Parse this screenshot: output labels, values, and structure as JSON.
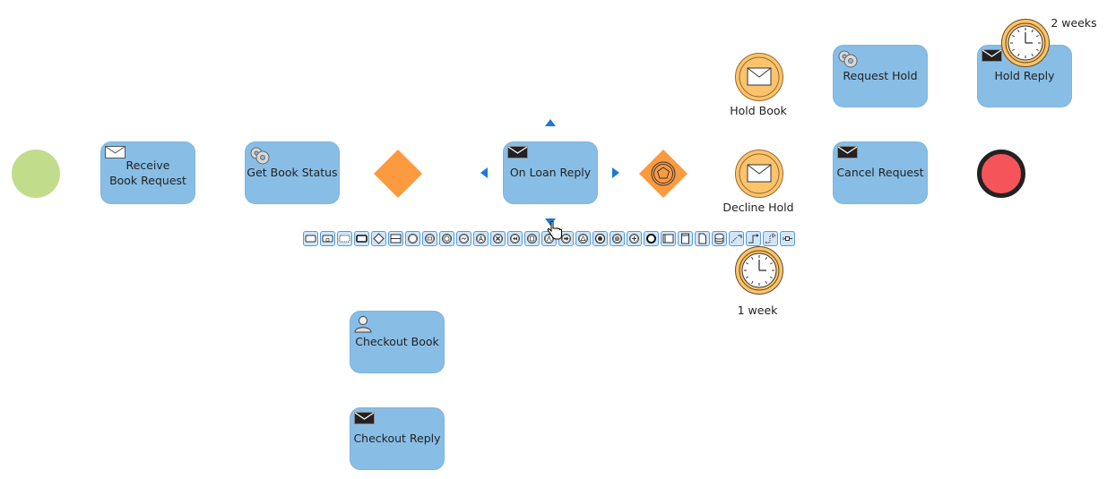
{
  "diagram": {
    "type": "BPMN process",
    "colors": {
      "task_fill": "#88bee6",
      "start_event": "#c1dd8c",
      "end_event": "#f5545a",
      "gateway": "#fc9a40",
      "intermediate_event": "#fbc46c",
      "selection_handle": "#1a7ad4"
    },
    "start_event": {
      "name": "start-event"
    },
    "end_event": {
      "name": "end-event"
    },
    "tasks": [
      {
        "id": "receive",
        "label_line1": "Receive",
        "label_line2": "Book Request",
        "icon": "envelope-outline-icon"
      },
      {
        "id": "get-status",
        "label": "Get Book Status",
        "icon": "gear-icon"
      },
      {
        "id": "on-loan",
        "label": "On Loan Reply",
        "icon": "envelope-filled-icon",
        "selected": true
      },
      {
        "id": "request-hold",
        "label": "Request Hold",
        "icon": "gear-icon"
      },
      {
        "id": "cancel-request",
        "label": "Cancel Request",
        "icon": "envelope-filled-icon"
      },
      {
        "id": "hold-reply",
        "label": "Hold Reply",
        "icon": "envelope-filled-icon"
      },
      {
        "id": "checkout-book",
        "label": "Checkout Book",
        "icon": "user-icon"
      },
      {
        "id": "checkout-reply",
        "label": "Checkout Reply",
        "icon": "envelope-filled-icon"
      }
    ],
    "gateways": [
      {
        "id": "exclusive",
        "type": "exclusive gateway"
      },
      {
        "id": "event-based",
        "type": "event-based gateway"
      }
    ],
    "intermediate_events": [
      {
        "id": "hold-book",
        "label": "Hold Book",
        "icon": "envelope-icon"
      },
      {
        "id": "decline-hold",
        "label": "Decline Hold",
        "icon": "envelope-icon"
      },
      {
        "id": "timer-1week",
        "label": "1 week",
        "icon": "clock-icon"
      },
      {
        "id": "timer-2weeks",
        "label": "2 weeks",
        "icon": "clock-icon"
      }
    ]
  },
  "toolbar": {
    "items": [
      "task",
      "sub-process",
      "call-activity",
      "transaction",
      "gateway",
      "lane",
      "intermediate-event",
      "message-event",
      "timer-event",
      "conditional-event",
      "link-event",
      "cancel-event",
      "compensation-event",
      "signal-event",
      "escalation-event",
      "link-throw-event",
      "error-event",
      "end-event",
      "multiple-event",
      "parallel-multiple-event",
      "terminate-event",
      "pool",
      "vertical-pool",
      "data-object",
      "data-store",
      "association",
      "sequence-flow",
      "message-flow",
      "connector"
    ]
  }
}
